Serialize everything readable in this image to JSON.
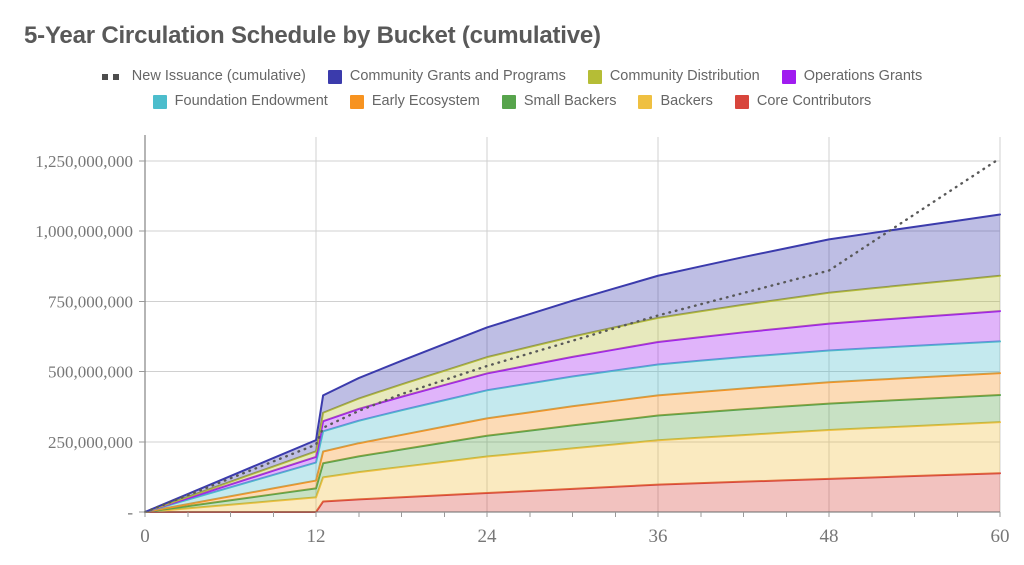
{
  "chart_title": "5-Year Circulation Schedule by Bucket (cumulative)",
  "legend": {
    "rows": [
      [
        {
          "label": "New Issuance (cumulative)",
          "color": "#4d4d4d",
          "marker": "dotted-line-marker"
        },
        {
          "label": "Community Grants and Programs",
          "color": "#3b3bac",
          "marker": "square-swatch"
        },
        {
          "label": "Community Distribution",
          "color": "#b5bd36",
          "marker": "square-swatch"
        },
        {
          "label": "Operations Grants",
          "color": "#a01cf0",
          "marker": "square-swatch"
        }
      ],
      [
        {
          "label": "Foundation Endowment",
          "color": "#4cbdcc",
          "marker": "square-swatch"
        },
        {
          "label": "Early Ecosystem",
          "color": "#f79320",
          "marker": "square-swatch"
        },
        {
          "label": "Small Backers",
          "color": "#57a44c",
          "marker": "square-swatch"
        },
        {
          "label": "Backers",
          "color": "#efc041",
          "marker": "square-swatch"
        },
        {
          "label": "Core Contributors",
          "color": "#d8453c",
          "marker": "square-swatch"
        }
      ]
    ]
  },
  "chart_data": {
    "type": "area",
    "stacked": true,
    "title": "5-Year Circulation Schedule by Bucket (cumulative)",
    "xlabel": "",
    "ylabel": "",
    "xlim": [
      0,
      60
    ],
    "ylim": [
      0,
      1300000000
    ],
    "grid": true,
    "legend_position": "top",
    "x": [
      0,
      3,
      6,
      9,
      12,
      12.5,
      15,
      18,
      21,
      24,
      27,
      30,
      33,
      36,
      39,
      42,
      45,
      48,
      51,
      54,
      57,
      60
    ],
    "xticks": [
      0,
      12,
      24,
      36,
      48,
      60
    ],
    "xticklabels": [
      "0",
      "12",
      "24",
      "36",
      "48",
      "60"
    ],
    "yticks": [
      0,
      250000000,
      500000000,
      750000000,
      1000000000,
      1250000000
    ],
    "yticklabels": [
      "-",
      "250,000,000",
      "500,000,000",
      "750,000,000",
      "1,000,000,000",
      "1,250,000,000"
    ],
    "stack_order_bottom_to_top": [
      "Core Contributors",
      "Backers",
      "Small Backers",
      "Early Ecosystem",
      "Foundation Endowment",
      "Operations Grants",
      "Community Distribution",
      "Community Grants and Programs"
    ],
    "series": [
      {
        "name": "Core Contributors",
        "color": "#d8453c",
        "values": [
          0,
          0,
          0,
          0,
          0,
          37500000,
          45000000,
          52500000,
          60000000,
          67500000,
          75000000,
          82500000,
          90000000,
          97500000,
          103000000,
          108000000,
          113000000,
          118000000,
          123000000,
          128000000,
          133000000,
          138000000
        ]
      },
      {
        "name": "Backers",
        "color": "#efc041",
        "values": [
          0,
          13000000,
          26000000,
          39000000,
          52000000,
          86000000,
          97000000,
          108000000,
          119000000,
          130000000,
          137000000,
          144000000,
          151000000,
          158000000,
          162000000,
          166000000,
          170000000,
          174000000,
          176000000,
          178000000,
          180000000,
          182000000
        ]
      },
      {
        "name": "Small Backers",
        "color": "#57a44c",
        "values": [
          0,
          8000000,
          16000000,
          24000000,
          32000000,
          50000000,
          56000000,
          62000000,
          68000000,
          74000000,
          78000000,
          82000000,
          85000000,
          88000000,
          90000000,
          92000000,
          93000000,
          94000000,
          95000000,
          95500000,
          96000000,
          96500000
        ]
      },
      {
        "name": "Early Ecosystem",
        "color": "#f79320",
        "values": [
          0,
          7000000,
          14000000,
          21000000,
          28000000,
          42000000,
          47000000,
          52000000,
          57000000,
          62000000,
          65000000,
          68000000,
          70000000,
          72000000,
          73000000,
          74000000,
          75000000,
          76000000,
          76500000,
          77000000,
          77500000,
          78000000
        ]
      },
      {
        "name": "Foundation Endowment",
        "color": "#4cbdcc",
        "values": [
          0,
          16000000,
          32000000,
          48000000,
          64000000,
          72000000,
          80000000,
          88000000,
          94000000,
          100000000,
          103000000,
          106000000,
          108000000,
          110000000,
          111000000,
          112000000,
          112500000,
          113000000,
          113000000,
          113000000,
          113000000,
          113000000
        ]
      },
      {
        "name": "Operations Grants",
        "color": "#a01cf0",
        "values": [
          0,
          5000000,
          10000000,
          15000000,
          20000000,
          36000000,
          42000000,
          48000000,
          54000000,
          60000000,
          65000000,
          70000000,
          75000000,
          80000000,
          84000000,
          88000000,
          92000000,
          96000000,
          99000000,
          102000000,
          105000000,
          108000000
        ]
      },
      {
        "name": "Community Distribution",
        "color": "#b5bd36",
        "values": [
          0,
          5000000,
          10000000,
          15000000,
          20000000,
          30000000,
          37000000,
          44000000,
          51000000,
          58000000,
          65000000,
          72000000,
          79000000,
          86000000,
          92000000,
          98000000,
          104000000,
          110000000,
          114000000,
          118000000,
          122000000,
          126000000
        ]
      },
      {
        "name": "Community Grants and Programs",
        "color": "#3b3bac",
        "values": [
          0,
          10000000,
          20000000,
          30000000,
          40000000,
          62000000,
          73000000,
          84000000,
          95000000,
          106000000,
          117000000,
          128000000,
          139000000,
          150000000,
          160000000,
          170000000,
          180000000,
          190000000,
          197000000,
          204000000,
          211000000,
          218000000
        ]
      }
    ],
    "overlay_series": [
      {
        "name": "New Issuance (cumulative)",
        "color": "#4d4d4d",
        "style": "dotted",
        "values": [
          0,
          60000000,
          120000000,
          180000000,
          240000000,
          300000000,
          360000000,
          420000000,
          470000000,
          520000000,
          565000000,
          610000000,
          655000000,
          700000000,
          740000000,
          780000000,
          820000000,
          860000000,
          960000000,
          1060000000,
          1160000000,
          1260000000
        ]
      }
    ]
  }
}
